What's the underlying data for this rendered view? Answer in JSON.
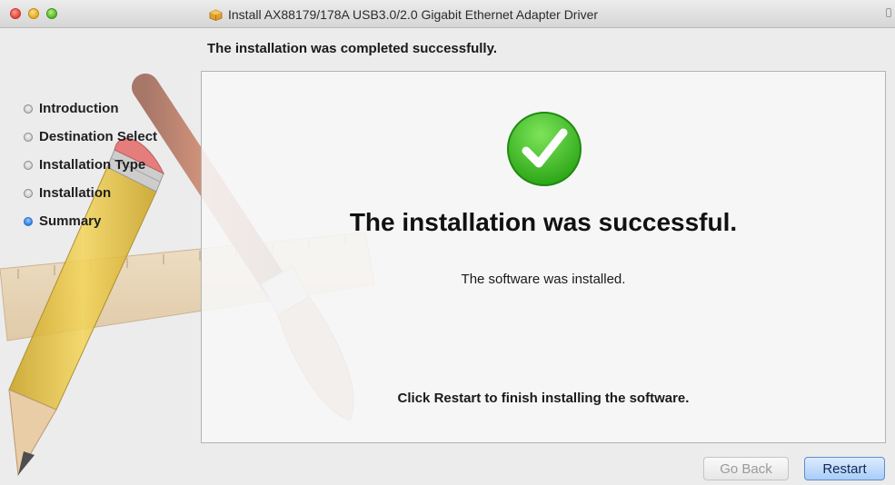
{
  "window": {
    "title": "Install AX88179/178A USB3.0/2.0 Gigabit Ethernet Adapter Driver"
  },
  "sidebar": {
    "items": [
      {
        "label": "Introduction",
        "state": "done"
      },
      {
        "label": "Destination Select",
        "state": "done"
      },
      {
        "label": "Installation Type",
        "state": "done"
      },
      {
        "label": "Installation",
        "state": "done"
      },
      {
        "label": "Summary",
        "state": "active"
      }
    ]
  },
  "main": {
    "header": "The installation was completed successfully.",
    "result_title": "The installation was successful.",
    "result_detail": "The software was installed.",
    "restart_note": "Click Restart to finish installing the software."
  },
  "buttons": {
    "back_label": "Go Back",
    "restart_label": "Restart"
  },
  "colors": {
    "success_green": "#3cbf1f",
    "active_step_blue": "#2f7ee8",
    "default_button": "#a9ccf7"
  },
  "icons": {
    "titlebar": "package-icon",
    "status": "checkmark-success-icon"
  }
}
